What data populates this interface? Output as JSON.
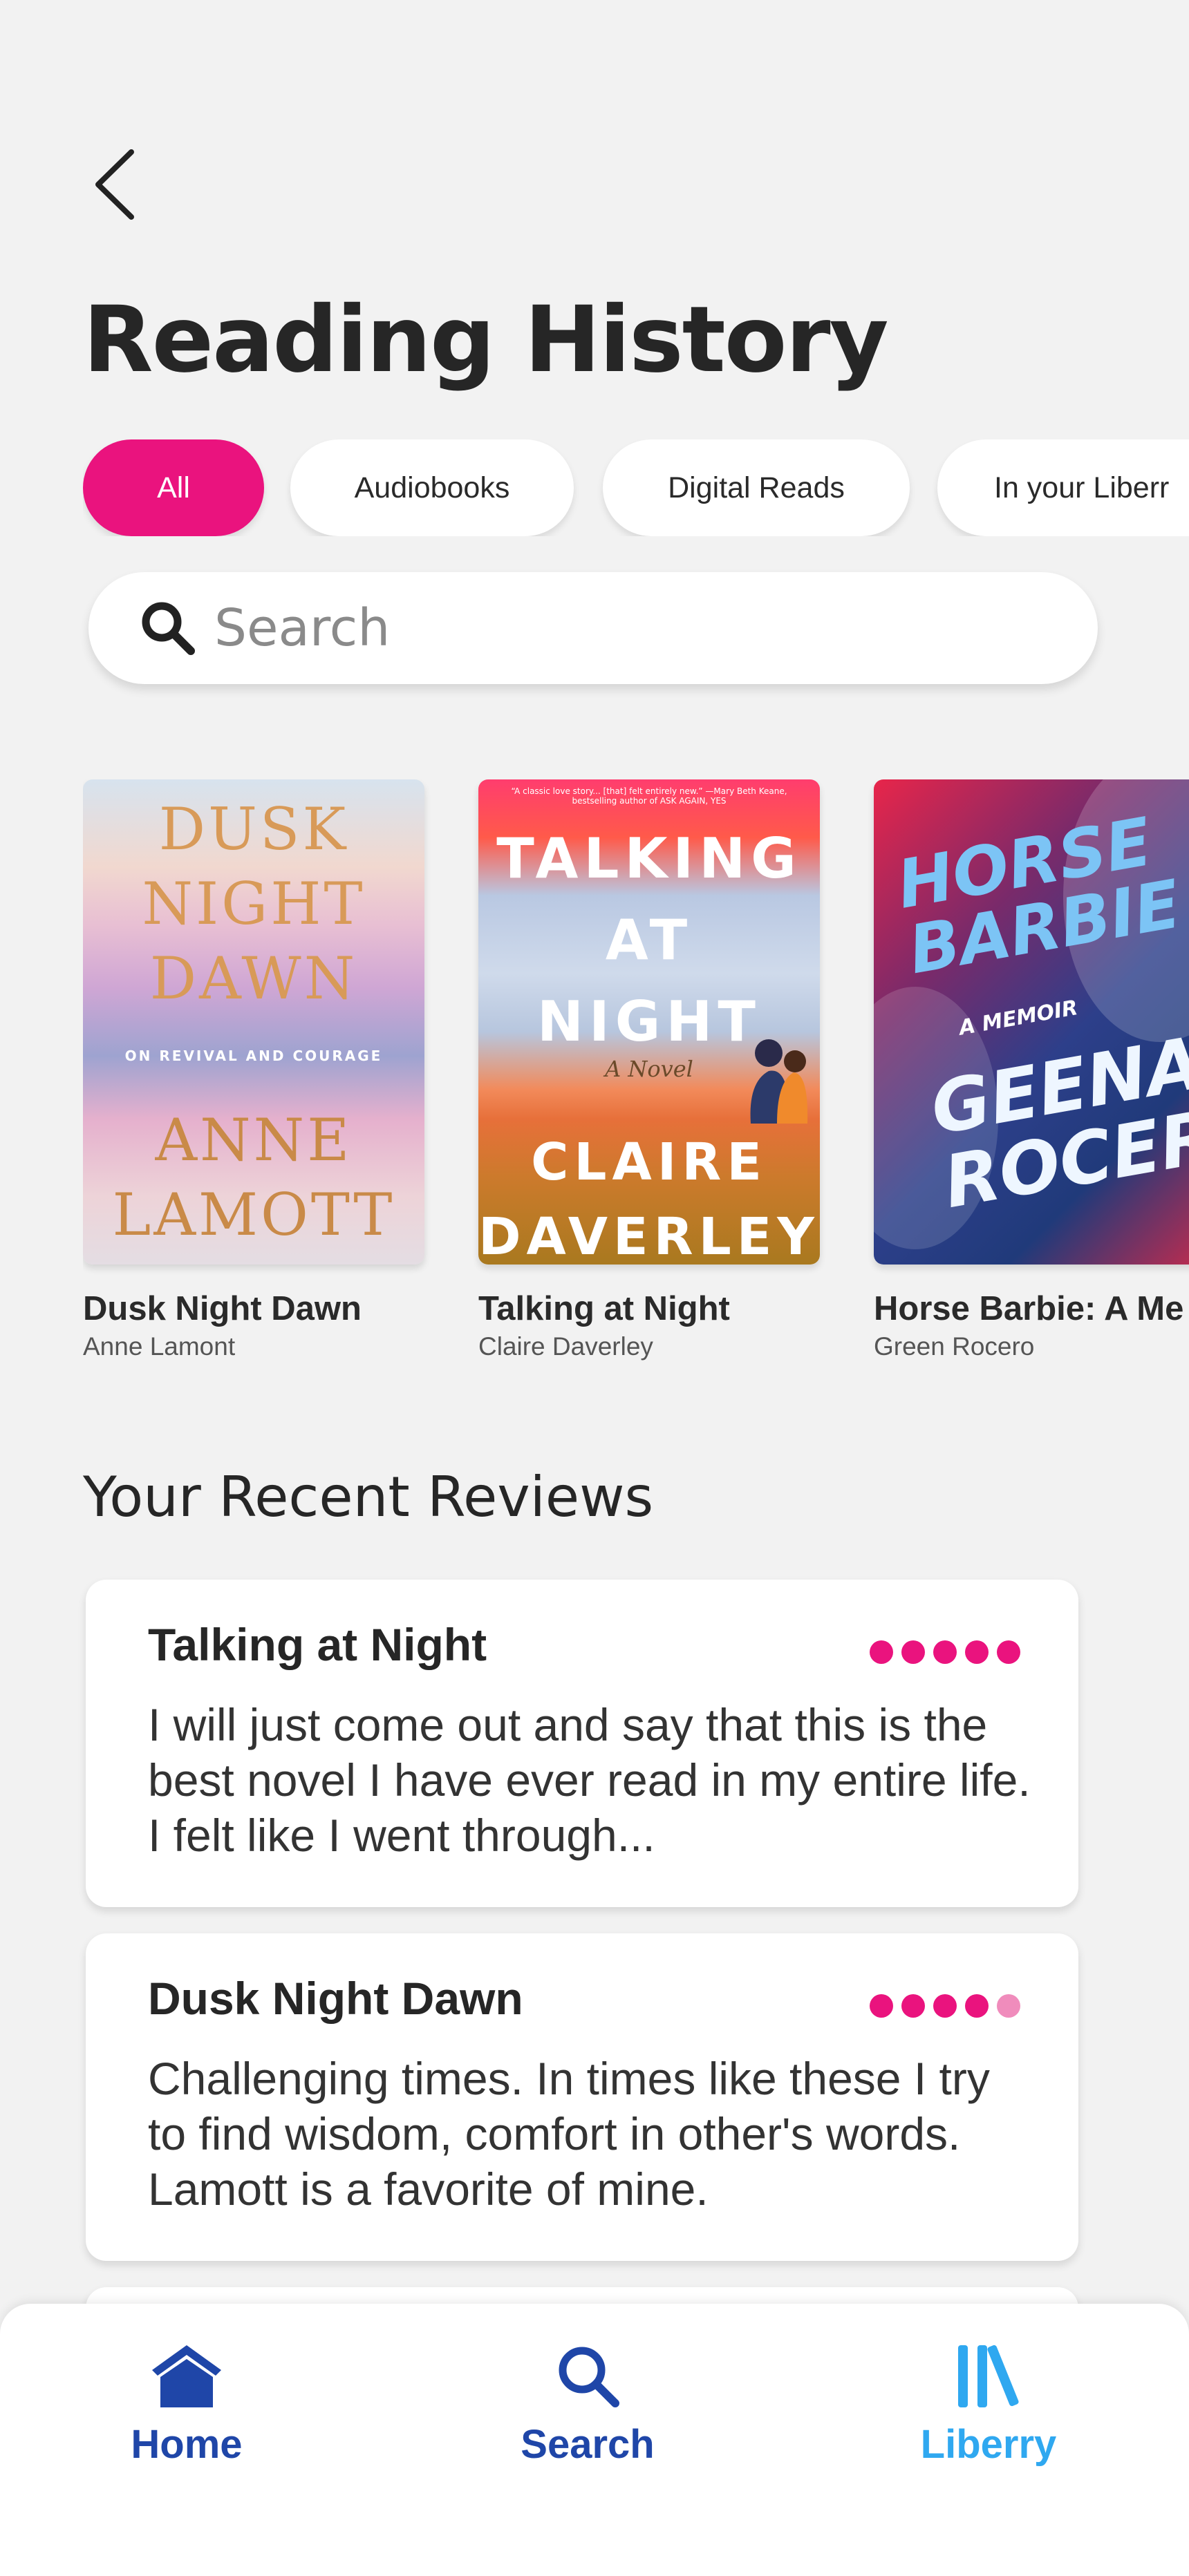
{
  "header": {
    "title": "Reading History"
  },
  "filters": [
    {
      "label": "All",
      "active": true
    },
    {
      "label": "Audiobooks",
      "active": false
    },
    {
      "label": "Digital Reads",
      "active": false
    },
    {
      "label": "In your Liberr",
      "active": false
    }
  ],
  "search": {
    "placeholder": "Search"
  },
  "books": [
    {
      "title": "Dusk Night Dawn",
      "author": "Anne Lamont",
      "cover": {
        "lines": [
          "DUSK",
          "NIGHT",
          "DAWN"
        ],
        "subtitle": "ON REVIVAL AND COURAGE",
        "author_lines": [
          "ANNE",
          "LAMOTT"
        ]
      }
    },
    {
      "title": "Talking at Night",
      "author": "Claire Daverley",
      "cover": {
        "blurb": "“A classic love story... [that] felt entirely new.” —Mary Beth Keane, bestselling author of ASK AGAIN, YES",
        "lines": [
          "TALKING",
          "AT",
          "NIGHT"
        ],
        "tag": "A Novel",
        "author_lines": [
          "CLAIRE",
          "DAVERLEY"
        ]
      }
    },
    {
      "title": "Horse Barbie: A Me",
      "author": "Green Rocero",
      "cover": {
        "lines": [
          "HORSE",
          "BARBIE"
        ],
        "subtitle": "A MEMOIR",
        "author_lines": [
          "GEENA",
          "ROCERO"
        ]
      }
    }
  ],
  "reviews_section": {
    "title": "Your Recent Reviews"
  },
  "reviews": [
    {
      "title": "Talking at Night",
      "rating": 5,
      "text": "I will just come out and say that this is the best novel I have ever read in my entire life. I felt like I went through..."
    },
    {
      "title": "Dusk Night Dawn",
      "rating": 4.5,
      "text": "Challenging times. In times like these I try to find wisdom, comfort in other's words. Lamott is a favorite of mine."
    }
  ],
  "nav": {
    "home": {
      "label": "Home",
      "color": "#1f46a8"
    },
    "search": {
      "label": "Search",
      "color": "#1f46a8"
    },
    "library": {
      "label": "Liberry",
      "color": "#2fa8f0",
      "active": true
    }
  },
  "colors": {
    "accent": "#ea137e",
    "background": "#f2f2f2"
  }
}
